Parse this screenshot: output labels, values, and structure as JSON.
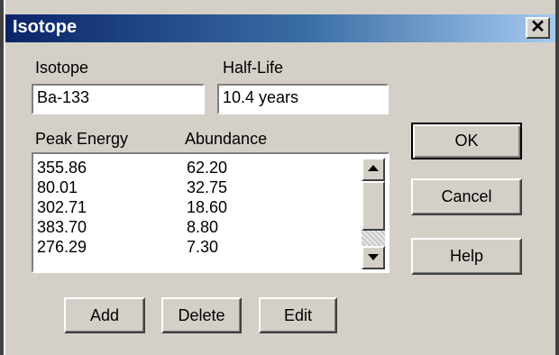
{
  "window": {
    "title": "Isotope"
  },
  "form": {
    "isotope_label": "Isotope",
    "isotope_value": "Ba-133",
    "halflife_label": "Half-Life",
    "halflife_value": "10.4 years"
  },
  "list": {
    "headers": [
      "Peak Energy",
      "Abundance"
    ],
    "rows": [
      [
        "355.86",
        "62.20"
      ],
      [
        "80.01",
        "32.75"
      ],
      [
        "302.71",
        "18.60"
      ],
      [
        "383.70",
        "8.80"
      ],
      [
        "276.29",
        "7.30"
      ]
    ],
    "scroll_up_icon": "triangle-up",
    "scroll_down_icon": "triangle-down"
  },
  "buttons": {
    "ok": "OK",
    "cancel": "Cancel",
    "help": "Help",
    "add": "Add",
    "delete": "Delete",
    "edit": "Edit"
  },
  "colors": {
    "titlebar_start": "#0a246a",
    "titlebar_end": "#a6caf0",
    "dialog_face": "#d4d0c8"
  }
}
